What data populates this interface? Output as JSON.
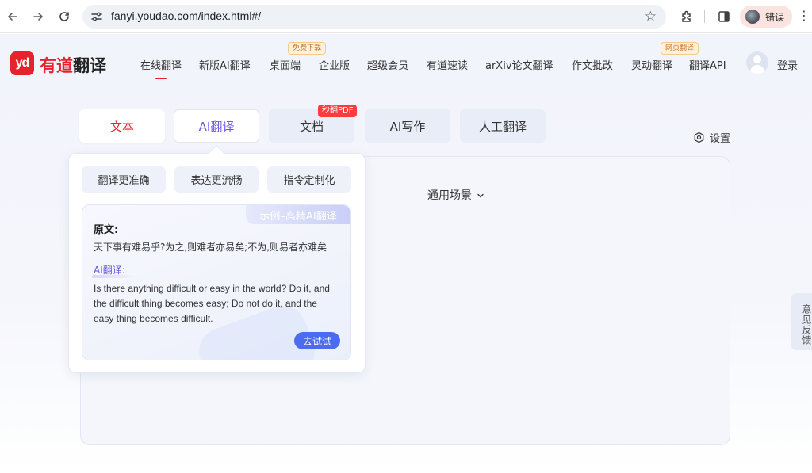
{
  "browser": {
    "url": "fanyi.youdao.com/index.html#/",
    "profile_label": "错误",
    "back_icon": "arrow-left",
    "forward_icon": "arrow-right",
    "reload_icon": "reload",
    "star_icon": "star",
    "extensions_icon": "puzzle",
    "sidepanel_icon": "side-panel",
    "more_icon": "more-vertical"
  },
  "logo": {
    "mark": "yd",
    "text_red": "有道",
    "text_dark": "翻译"
  },
  "topnav": {
    "items": [
      {
        "label": "在线翻译",
        "active": true
      },
      {
        "label": "新版AI翻译"
      },
      {
        "label": "桌面端",
        "badge": "免费下载"
      },
      {
        "label": "企业版"
      },
      {
        "label": "超级会员"
      },
      {
        "label": "有道速读"
      },
      {
        "label": "arXiv论文翻译"
      },
      {
        "label": "作文批改"
      },
      {
        "label": "灵动翻译",
        "badge": "网页翻译"
      },
      {
        "label": "翻译API"
      }
    ],
    "login": "登录"
  },
  "mode_tabs": [
    {
      "label": "文本"
    },
    {
      "label": "AI翻译"
    },
    {
      "label": "文档",
      "badge": "秒翻PDF"
    },
    {
      "label": "AI写作"
    },
    {
      "label": "人工翻译"
    }
  ],
  "settings": {
    "label": "设置",
    "icon": "gear-hex"
  },
  "ai_panel": {
    "features": [
      "翻译更准确",
      "表达更流畅",
      "指令定制化"
    ],
    "example": {
      "tag": "示例–高精AI翻译",
      "original_label": "原文:",
      "original_text": "天下事有难易乎?为之,则难者亦易矣;不为,则易者亦难矣",
      "ai_label": "AI翻译:",
      "ai_text": "Is there anything difficult or easy in the world? Do it, and the difficult thing becomes easy; Do not do it, and the easy thing becomes difficult.",
      "try_button": "去试试"
    }
  },
  "target_panel": {
    "scene": "通用场景"
  },
  "feedback": {
    "label": "意见反馈"
  },
  "colors": {
    "brand_red": "#e8222d",
    "ai_purple": "#6a55e0",
    "button_blue": "#4c6cf0"
  }
}
